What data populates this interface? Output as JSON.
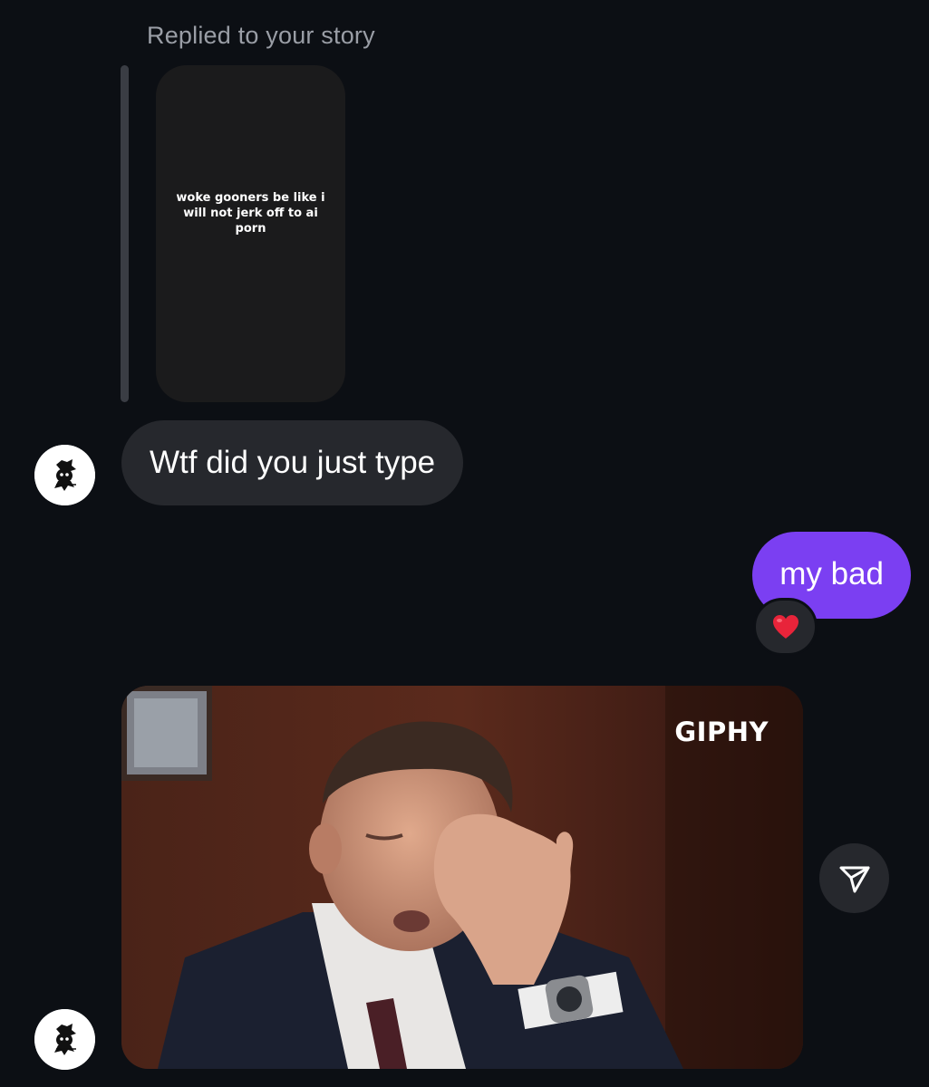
{
  "story_reply": {
    "caption": "Replied to your story",
    "story_text": "woke gooners be like i will not jerk off to ai porn"
  },
  "messages": [
    {
      "direction": "incoming",
      "text": "Wtf did you just type"
    },
    {
      "direction": "outgoing",
      "text": "my bad",
      "reaction": "heart-emoji"
    },
    {
      "direction": "incoming",
      "type": "gif",
      "watermark": "GIPHY"
    }
  ],
  "colors": {
    "background": "#0c0f14",
    "incoming_bubble": "#26282d",
    "outgoing_bubble": "#7b3ff2",
    "caption_text": "#9a9ea6"
  },
  "icons": {
    "reaction": "heart-emoji",
    "share": "send-paper-plane-icon",
    "avatar": "user-avatar-icon"
  }
}
